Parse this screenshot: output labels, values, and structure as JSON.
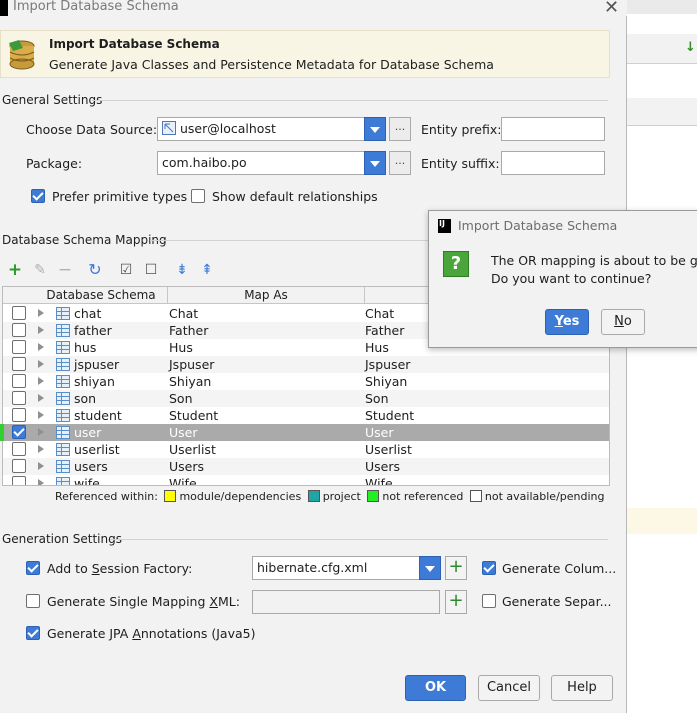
{
  "dialog": {
    "title": "Import Database Schema",
    "header_title": "Import Database Schema",
    "header_subtitle": "Generate Java Classes and Persistence Metadata for Database Schema"
  },
  "general": {
    "section_title": "General Settings",
    "data_source_label": "Choose Data Source:",
    "data_source_value": "user@localhost",
    "package_label": "Package:",
    "package_value": "com.haibo.po",
    "entity_prefix_label": "Entity prefix:",
    "entity_prefix_value": "",
    "entity_suffix_label": "Entity suffix:",
    "entity_suffix_value": "",
    "prefer_primitive_label": "Prefer primitive types",
    "prefer_primitive_checked": true,
    "show_relationships_label": "Show default relationships",
    "show_relationships_checked": false,
    "ellipsis": "..."
  },
  "mapping": {
    "section_title": "Database Schema Mapping",
    "columns": [
      "Database Schema",
      "Map As",
      ""
    ],
    "rows": [
      {
        "schema": "chat",
        "map_as": "Chat",
        "entity": "Chat",
        "checked": false
      },
      {
        "schema": "father",
        "map_as": "Father",
        "entity": "Father",
        "checked": false
      },
      {
        "schema": "hus",
        "map_as": "Hus",
        "entity": "Hus",
        "checked": false
      },
      {
        "schema": "jspuser",
        "map_as": "Jspuser",
        "entity": "Jspuser",
        "checked": false
      },
      {
        "schema": "shiyan",
        "map_as": "Shiyan",
        "entity": "Shiyan",
        "checked": false
      },
      {
        "schema": "son",
        "map_as": "Son",
        "entity": "Son",
        "checked": false
      },
      {
        "schema": "student",
        "map_as": "Student",
        "entity": "Student",
        "checked": false
      },
      {
        "schema": "user",
        "map_as": "User",
        "entity": "User",
        "checked": true,
        "selected": true
      },
      {
        "schema": "userlist",
        "map_as": "Userlist",
        "entity": "Userlist",
        "checked": false
      },
      {
        "schema": "users",
        "map_as": "Users",
        "entity": "Users",
        "checked": false
      },
      {
        "schema": "wife",
        "map_as": "Wife",
        "entity": "Wife",
        "checked": false
      }
    ],
    "legend": {
      "prefix": "Referenced within:",
      "items": [
        {
          "label": "module/dependencies",
          "color": "#ffff00"
        },
        {
          "label": "project",
          "color": "#1fa5a5"
        },
        {
          "label": "not referenced",
          "color": "#22ee22"
        },
        {
          "label": "not available/pending",
          "color": "#ffffff"
        }
      ]
    }
  },
  "generation": {
    "section_title": "Generation Settings",
    "session_factory_label": "Add to Session Factory:",
    "session_factory_checked": true,
    "session_factory_value": "hibernate.cfg.xml",
    "single_mapping_label": "Generate Single Mapping XML:",
    "single_mapping_checked": false,
    "single_mapping_value": "",
    "jpa_label": "Generate JPA Annotations (Java5)",
    "jpa_checked": true,
    "gen_columns_label": "Generate Colum...",
    "gen_columns_checked": true,
    "gen_separate_label": "Generate Separ...",
    "gen_separate_checked": false
  },
  "buttons": {
    "ok": "OK",
    "cancel": "Cancel",
    "help": "Help"
  },
  "confirm": {
    "title": "Import Database Schema",
    "message_line1": "The OR mapping is about to be gen",
    "message_line2": "Do you want to continue?",
    "yes": "Yes",
    "no": "No"
  },
  "icons": [
    "database-icon",
    "close-icon",
    "datasource-icon",
    "add-icon",
    "edit-icon",
    "remove-icon",
    "refresh-icon",
    "check-all-icon",
    "uncheck-all-icon",
    "expand-all-icon",
    "collapse-all-icon",
    "table-icon",
    "question-icon"
  ]
}
